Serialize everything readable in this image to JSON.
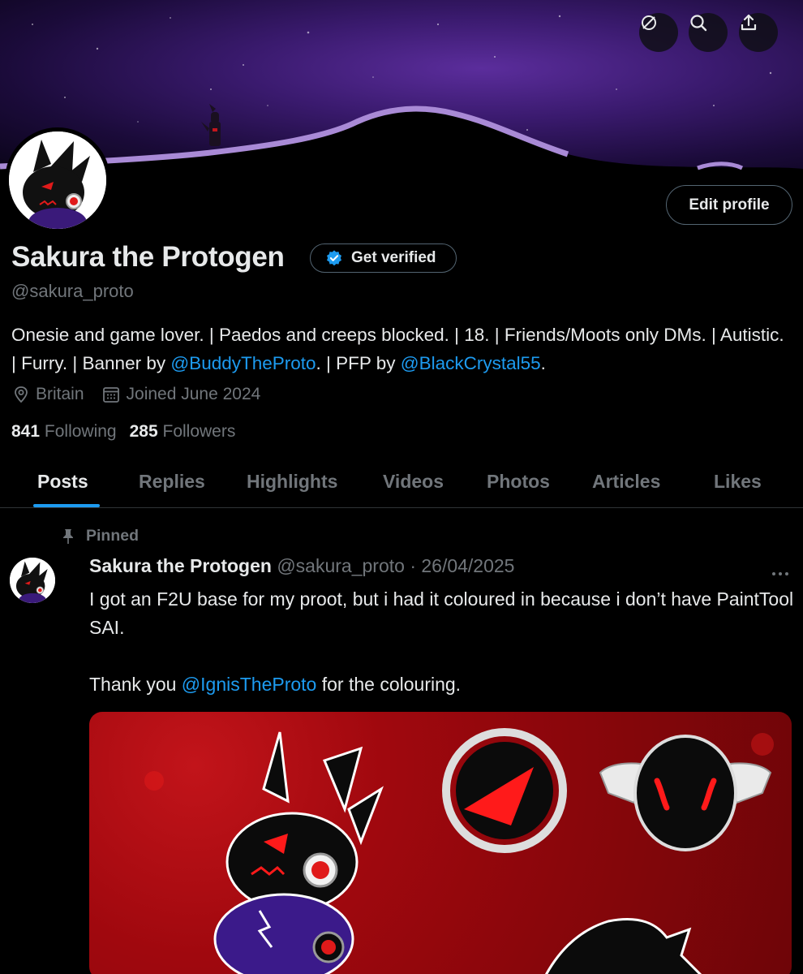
{
  "banner": {
    "buttons": [
      {
        "name": "unfollow-icon"
      },
      {
        "name": "search-icon"
      },
      {
        "name": "share-icon"
      }
    ]
  },
  "profile": {
    "name": "Sakura the Protogen",
    "verify_label": "Get verified",
    "handle": "@sakura_proto",
    "edit_label": "Edit profile",
    "bio_part1": "Onesie and game lover. | Paedos and creeps blocked. | 18. | Friends/Moots only DMs. | Autistic. | Furry. | Banner by ",
    "bio_link1": "@BuddyTheProto",
    "bio_part2": ". | PFP by ",
    "bio_link2": "@BlackCrystal55",
    "bio_part3": ".",
    "location": "Britain",
    "joined": "Joined June 2024",
    "following_count": "841",
    "following_label": "Following",
    "followers_count": "285",
    "followers_label": "Followers"
  },
  "tabs": [
    "Posts",
    "Replies",
    "Highlights",
    "Videos",
    "Photos",
    "Articles",
    "Likes"
  ],
  "active_tab": "Posts",
  "post": {
    "pinned_label": "Pinned",
    "author": "Sakura the Protogen",
    "handle_date": "@sakura_proto · 26/04/2025",
    "line1": "I got an F2U base for my proot, but i had it coloured in because i don’t have PaintTool SAI.",
    "line2_prefix": "Thank you ",
    "line2_link": "@IgnisTheProto",
    "line2_suffix": " for the colouring."
  },
  "colors": {
    "accent": "#1d9bf0",
    "background": "#000000",
    "secondary_text": "#71767b",
    "primary_text": "#e7e9ea",
    "banner_purple": "#5b2d9c",
    "media_red": "#a0080e"
  }
}
